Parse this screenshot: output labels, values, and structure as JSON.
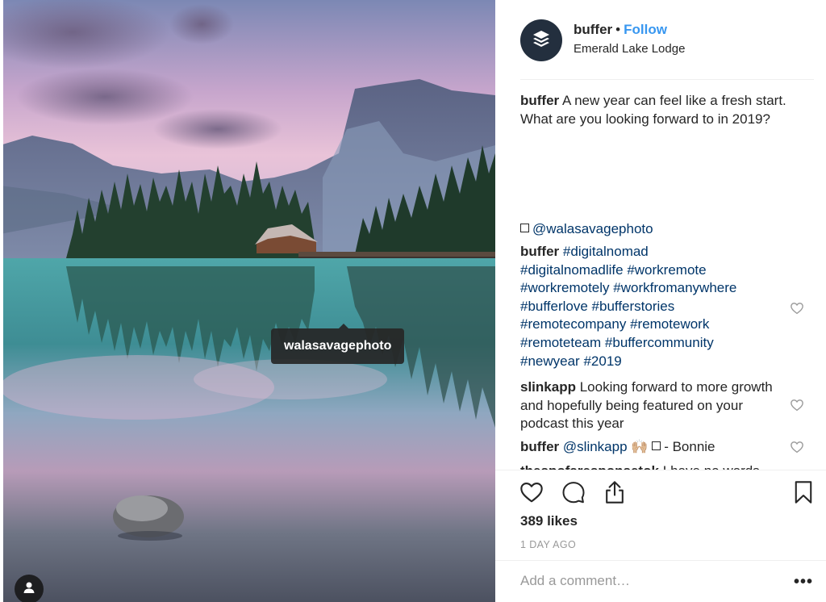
{
  "photo": {
    "tagged_user": "walasavagephoto",
    "user_tag_button_icon": "user-icon"
  },
  "header": {
    "username": "buffer",
    "separator": "•",
    "follow_label": "Follow",
    "location": "Emerald Lake Lodge",
    "avatar_icon": "buffer-logo-icon",
    "colors": {
      "follow": "#3897f0",
      "avatar_bg": "#232f3e"
    }
  },
  "caption": {
    "username": "buffer",
    "text": "A new year can feel like a fresh start. What are you looking forward to in 2019?",
    "mention_line": "@walasavagephoto"
  },
  "comments": [
    {
      "username": "buffer",
      "hashtags": [
        "#digitalnomad",
        "#digitalnomadlife",
        "#workremote",
        "#workremotely",
        "#workfromanywhere",
        "#bufferlove",
        "#bufferstories",
        "#remotecompany",
        "#remotework",
        "#remoteteam",
        "#buffercommunity",
        "#newyear",
        "#2019"
      ]
    },
    {
      "username": "slinkapp",
      "text": "Looking forward to more growth and hopefully being featured on your podcast this year"
    },
    {
      "username": "buffer",
      "mention": "@slinkapp",
      "emoji": "🙌🏼",
      "text": "- Bonnie"
    },
    {
      "username": "thespofaresponsetok",
      "text": "I have no words"
    }
  ],
  "actions": {
    "like_icon": "heart-icon",
    "comment_icon": "comment-icon",
    "share_icon": "share-icon",
    "save_icon": "bookmark-icon"
  },
  "likes": "389 likes",
  "timestamp": "1 DAY AGO",
  "add_comment": {
    "placeholder": "Add a comment…",
    "more_label": "•••"
  }
}
